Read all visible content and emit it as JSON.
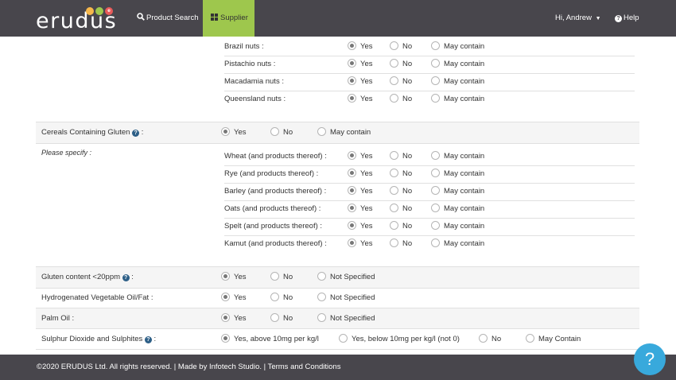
{
  "nav": {
    "logo": "erudus",
    "dots": [
      {
        "letter": "",
        "color": "#f7b84b"
      },
      {
        "letter": "",
        "color": "#9ec74d"
      },
      {
        "letter": "e",
        "color": "#e85a5a"
      }
    ],
    "product_search": "Product Search",
    "supplier": "Supplier",
    "user": "Hi, Andrew",
    "help": "Help"
  },
  "options": {
    "yes": "Yes",
    "no": "No",
    "may": "May contain",
    "may_cap": "May Contain",
    "not_specified": "Not Specified"
  },
  "nuts": [
    {
      "label": "Brazil nuts :"
    },
    {
      "label": "Pistachio nuts :"
    },
    {
      "label": "Macadamia nuts :"
    },
    {
      "label": "Queensland nuts :"
    }
  ],
  "cereals": {
    "label": "Cereals Containing Gluten",
    "suffix": " :",
    "specify": "Please specify :"
  },
  "grains": [
    {
      "label": "Wheat (and products thereof) :"
    },
    {
      "label": "Rye (and products thereof) :"
    },
    {
      "label": "Barley (and products thereof) :"
    },
    {
      "label": "Oats (and products thereof) :"
    },
    {
      "label": "Spelt (and products thereof) :"
    },
    {
      "label": "Kamut (and products thereof) :"
    }
  ],
  "gluten_content": {
    "label": "Gluten content <20ppm",
    "suffix": " :"
  },
  "hydrogenated": {
    "label": "Hydrogenated Vegetable Oil/Fat :"
  },
  "palm": {
    "label": "Palm Oil :"
  },
  "sulphur": {
    "label": "Sulphur Dioxide and Sulphites",
    "suffix": " :",
    "opt1": "Yes, above 10mg per kg/l",
    "opt2": "Yes, below 10mg per kg/l (not 0)"
  },
  "footer": {
    "text": "©2020 ERUDUS Ltd. All rights reserved. | Made by Infotech Studio. | Terms and Conditions"
  },
  "fab": {
    "label": "?"
  },
  "help_glyph": "?"
}
